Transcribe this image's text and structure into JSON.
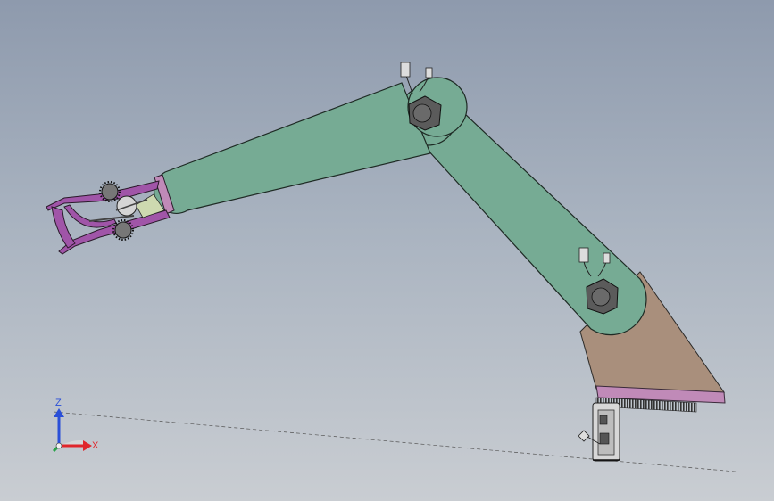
{
  "viewport": {
    "model": "robotic-arm-assembly",
    "background_top": "#8e9aad",
    "background_bottom": "#c9cdd2"
  },
  "colors": {
    "link": "#76ab94",
    "link_stroke": "#2c3a33",
    "base_bracket": "#a98f7c",
    "pink_plate": "#c08ab8",
    "gripper": "#a055a8",
    "motor": "#5a5a5a",
    "axis_x": "#e0262b",
    "axis_y": "#2aa34a",
    "axis_z": "#2a4fd8"
  },
  "triad": {
    "x_label": "X",
    "z_label": "Z",
    "icons": [
      "axis-triad-icon"
    ]
  }
}
